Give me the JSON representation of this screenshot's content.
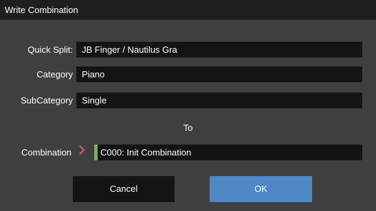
{
  "dialog": {
    "title": "Write Combination",
    "fields": {
      "quick_split": {
        "label": "Quick Split:",
        "value": "JB Finger / Nautilus Gra"
      },
      "category": {
        "label": "Category",
        "value": "Piano"
      },
      "subcategory": {
        "label": "SubCategory",
        "value": "Single"
      }
    },
    "to_label": "To",
    "target": {
      "label": "Combination",
      "value": "C000: Init Combination",
      "arrow_icon": "chevron-right-icon",
      "arrow_color": "#e0636e",
      "focus_color": "#7fae5a"
    },
    "buttons": {
      "cancel": "Cancel",
      "ok": "OK",
      "ok_color": "#4f87c4"
    }
  }
}
